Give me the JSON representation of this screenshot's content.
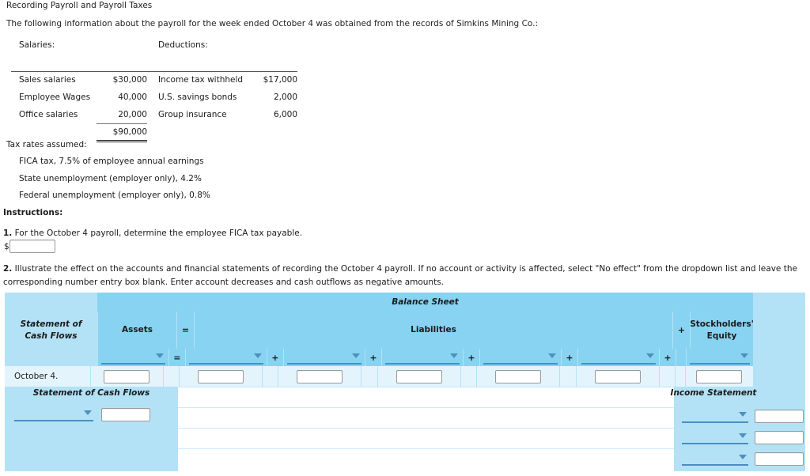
{
  "title": "Recording Payroll and Payroll Taxes",
  "intro": "The following information about the payroll for the week ended October 4 was obtained from the records of Simkins Mining Co.:",
  "payroll_table": {
    "salaries_header": "Salaries:",
    "deductions_header": "Deductions:",
    "rows": [
      {
        "salary_label": "Sales salaries",
        "salary_amount": "$30,000",
        "deduction_label": "Income tax withheld",
        "deduction_amount": "$17,000"
      },
      {
        "salary_label": "Employee Wages",
        "salary_amount": "40,000",
        "deduction_label": "U.S. savings bonds",
        "deduction_amount": "2,000"
      },
      {
        "salary_label": "Office salaries",
        "salary_amount": "20,000",
        "deduction_label": "Group insurance",
        "deduction_amount": "6,000"
      }
    ],
    "salaries_total": "$90,000"
  },
  "tax_rates": {
    "header": "Tax rates assumed:",
    "items": [
      "FICA tax, 7.5% of employee annual earnings",
      "State unemployment (employer only), 4.2%",
      "Federal unemployment (employer only), 0.8%"
    ]
  },
  "instructions": {
    "header": "Instructions:",
    "q1_number": "1.",
    "q1_text": "For the October 4 payroll, determine the employee FICA tax payable.",
    "q1_currency": "$",
    "q1_value": "",
    "q2_number": "2.",
    "q2_text": "Illustrate the effect on the accounts and financial statements of recording the October 4 payroll. If no account or activity is affected, select \"No effect\" from the dropdown list and leave the corresponding number entry box blank. Enter account decreases and cash outflows as negative amounts."
  },
  "effects_grid": {
    "balance_sheet_label": "Balance Sheet",
    "statement_of_cash_flows_label": "Statement of\nCash Flows",
    "scf_line1": "Statement of",
    "scf_line2": "Cash Flows",
    "assets_label": "Assets",
    "liabilities_label": "Liabilities",
    "stockholders_equity_line1": "Stockholders'",
    "stockholders_equity_line2": "Equity",
    "equals_operator": "=",
    "plus_operator": "+",
    "row_label": "October 4.",
    "dropdown_placeholder": "",
    "input_value": "",
    "selectors": [
      {
        "name": "assets-selector",
        "value": ""
      },
      {
        "name": "liability-selector-1",
        "value": ""
      },
      {
        "name": "liability-selector-2",
        "value": ""
      },
      {
        "name": "liability-selector-3",
        "value": ""
      },
      {
        "name": "liability-selector-4",
        "value": ""
      },
      {
        "name": "liability-selector-5",
        "value": ""
      },
      {
        "name": "stockholders-equity-selector",
        "value": ""
      }
    ],
    "amount_inputs": [
      "",
      "",
      "",
      "",
      "",
      "",
      ""
    ]
  },
  "cash_flows_section": {
    "title": "Statement of Cash Flows",
    "selector_value": "",
    "amount_value": ""
  },
  "income_statement_section": {
    "title": "Income Statement",
    "rows": [
      {
        "selector_value": "",
        "amount_value": ""
      },
      {
        "selector_value": "",
        "amount_value": ""
      },
      {
        "selector_value": "",
        "amount_value": ""
      }
    ]
  },
  "colors": {
    "band_blue": "#88d3f2",
    "panel_blue": "#b3e2f7",
    "row_blue": "#e4f4fd",
    "underline_blue": "#4a8fc0"
  }
}
